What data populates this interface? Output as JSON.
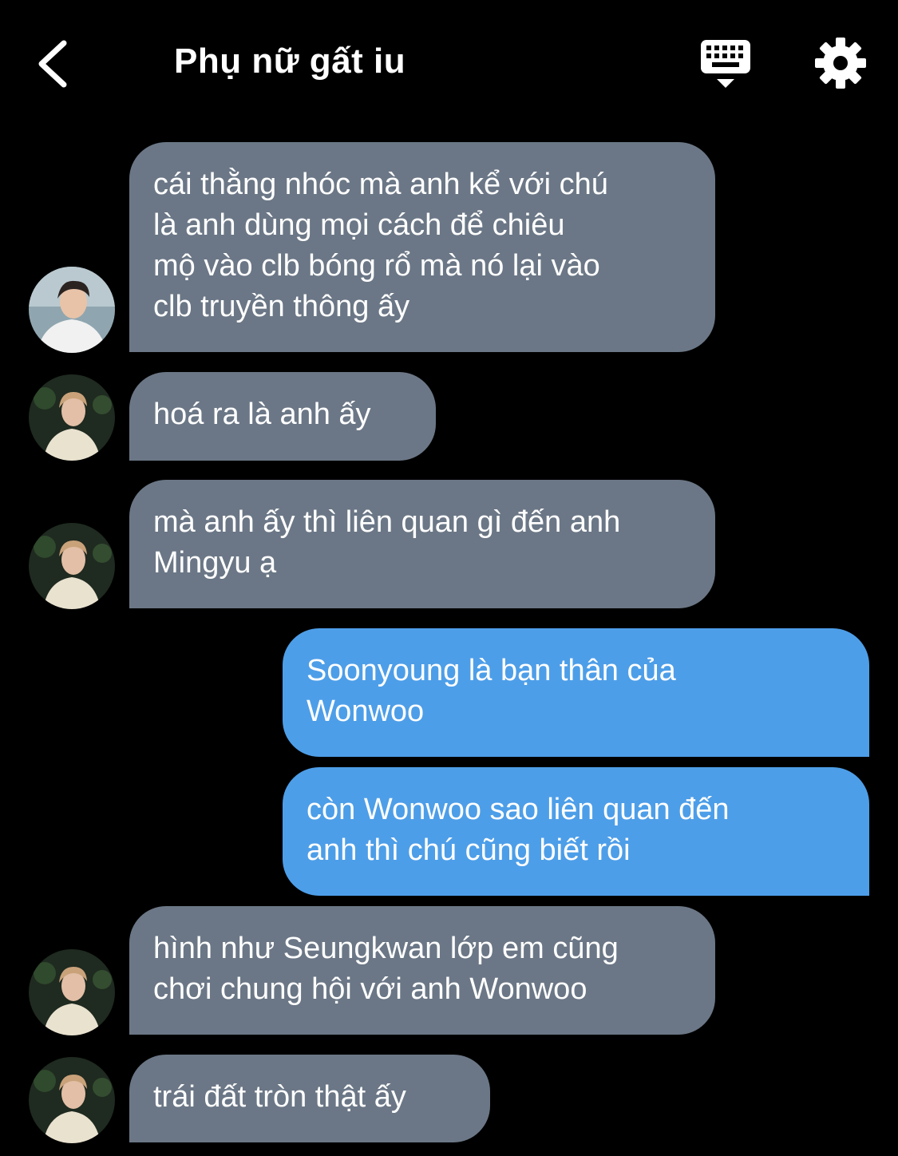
{
  "header": {
    "title": "Phụ nữ gất iu",
    "back_icon": "chevron-left-icon",
    "keyboard_icon": "keyboard-hide-icon",
    "settings_icon": "gear-icon"
  },
  "colors": {
    "background": "#000000",
    "received_bubble": "#6b7786",
    "sent_bubble": "#4d9ee8",
    "text": "#ffffff"
  },
  "messages": [
    {
      "from": "other",
      "avatar": "avatar-white-shirt",
      "text": "cái thằng nhóc mà anh kể với chú\nlà anh dùng mọi cách để chiêu\nmộ vào clb bóng rổ mà nó lại vào\nclb truyền thông ấy"
    },
    {
      "from": "other",
      "avatar": "avatar-jacket",
      "text": " hoá ra là anh ấy"
    },
    {
      "from": "other",
      "avatar": "avatar-jacket",
      "text": "mà anh ấy thì liên quan gì đến anh\nMingyu ạ"
    },
    {
      "from": "me",
      "text": "Soonyoung là bạn thân của\nWonwoo"
    },
    {
      "from": "me",
      "text": "còn Wonwoo sao liên quan đến\nanh thì chú cũng biết rồi"
    },
    {
      "from": "other",
      "avatar": "avatar-jacket",
      "text": "hình như Seungkwan lớp em cũng\nchơi chung hội với anh Wonwoo"
    },
    {
      "from": "other",
      "avatar": "avatar-jacket",
      "text": "trái đất tròn thật ấy"
    }
  ]
}
